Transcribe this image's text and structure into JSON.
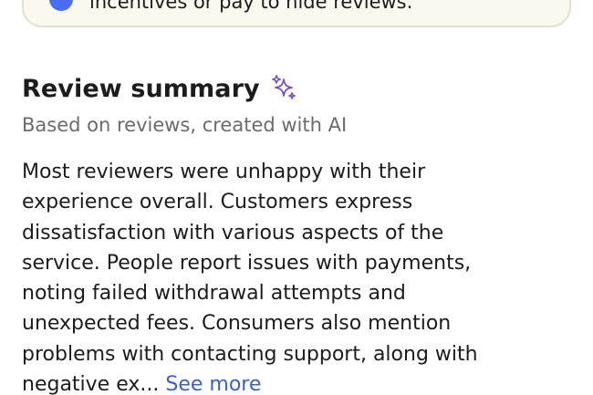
{
  "notice": {
    "text": "incentives or pay to hide reviews."
  },
  "review_summary": {
    "title": "Review summary",
    "subtitle": "Based on reviews, created with AI",
    "body_lines": [
      "Most reviewers were unhappy with their",
      "experience overall. Customers express",
      "dissatisfaction with various aspects of the",
      "service. People report issues with payments,",
      "noting failed withdrawal attempts and",
      "unexpected fees. Consumers also mention",
      "problems with contacting support, along with",
      "negative ex..."
    ],
    "see_more_label": "See more",
    "sparkle_icon": "sparkle-ai-icon",
    "sparkle_color": "#7b4fc9"
  },
  "colors": {
    "notice_background": "#fbf8f0",
    "notice_border": "#e3dfd5",
    "notice_icon": "#4a6cf0",
    "link": "#3d5fc9",
    "secondary_text": "#6b6b6b"
  }
}
